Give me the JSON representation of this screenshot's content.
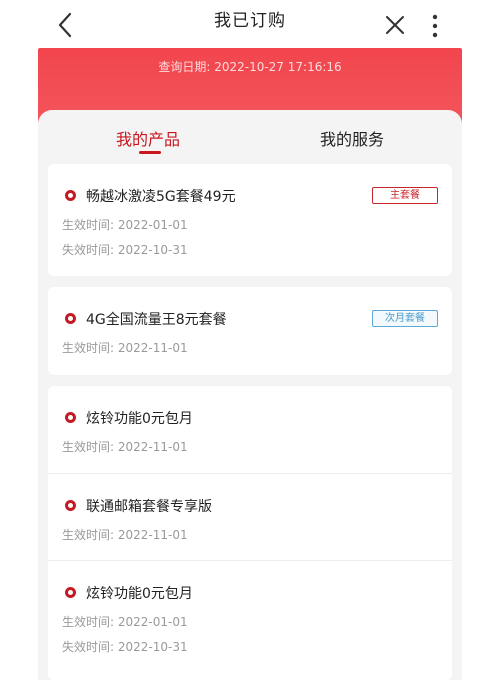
{
  "header": {
    "title": "我已订购",
    "back_icon": "chevron-left-icon",
    "close_icon": "close-icon",
    "more_icon": "more-vertical-icon"
  },
  "banner": {
    "query_date_label": "查询日期:",
    "query_date_value": "2022-10-27 17:16:16"
  },
  "tabs": [
    {
      "label": "我的产品",
      "active": true
    },
    {
      "label": "我的服务",
      "active": false
    }
  ],
  "colors": {
    "accent": "#c8171f",
    "banner": "#f2454d",
    "next_tag": "#5aa9d6"
  },
  "labels": {
    "effective": "生效时间:",
    "expire": "失效时间:"
  },
  "products": [
    {
      "name": "畅越冰激凌5G套餐49元",
      "tag": "主套餐",
      "effective": "2022-01-01",
      "expire": "2022-10-31"
    },
    {
      "name": "4G全国流量王8元套餐",
      "tag": "次月套餐",
      "effective": "2022-11-01"
    },
    {
      "name": "炫铃功能0元包月",
      "effective": "2022-11-01"
    },
    {
      "name": "联通邮箱套餐专享版",
      "effective": "2022-11-01"
    },
    {
      "name": "炫铃功能0元包月",
      "effective": "2022-01-01",
      "expire": "2022-10-31"
    }
  ]
}
